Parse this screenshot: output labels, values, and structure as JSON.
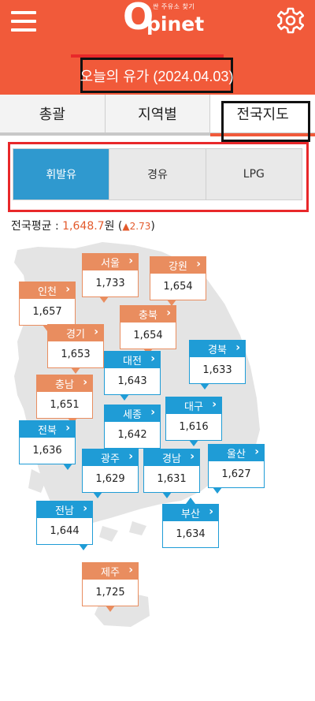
{
  "header": {
    "logo_tagline": "싼 주유소 찾기",
    "logo_o": "O",
    "logo_text": "pinet",
    "date_label": "오늘의 유가 (2024.04.03)",
    "bg_color": "#f15a3a"
  },
  "tabs": [
    {
      "label": "총괄"
    },
    {
      "label": "지역별"
    },
    {
      "label": "전국지도",
      "active": true
    }
  ],
  "fuel_types": [
    {
      "label": "휘발유",
      "active": true
    },
    {
      "label": "경유"
    },
    {
      "label": "LPG"
    }
  ],
  "average": {
    "prefix": "전국평균 : ",
    "value": "1,648.7",
    "unit": "원",
    "change_open": " (",
    "change": "▲2.73",
    "change_close": ")"
  },
  "regions": [
    {
      "name": "서울",
      "price": "1,733",
      "color": "orange"
    },
    {
      "name": "강원",
      "price": "1,654",
      "color": "orange"
    },
    {
      "name": "인천",
      "price": "1,657",
      "color": "orange"
    },
    {
      "name": "충북",
      "price": "1,654",
      "color": "orange"
    },
    {
      "name": "경기",
      "price": "1,653",
      "color": "orange"
    },
    {
      "name": "경북",
      "price": "1,633",
      "color": "blue"
    },
    {
      "name": "대전",
      "price": "1,643",
      "color": "blue"
    },
    {
      "name": "충남",
      "price": "1,651",
      "color": "orange"
    },
    {
      "name": "대구",
      "price": "1,616",
      "color": "blue"
    },
    {
      "name": "세종",
      "price": "1,642",
      "color": "blue"
    },
    {
      "name": "전북",
      "price": "1,636",
      "color": "blue"
    },
    {
      "name": "울산",
      "price": "1,627",
      "color": "blue"
    },
    {
      "name": "광주",
      "price": "1,629",
      "color": "blue"
    },
    {
      "name": "경남",
      "price": "1,631",
      "color": "blue"
    },
    {
      "name": "전남",
      "price": "1,644",
      "color": "blue"
    },
    {
      "name": "부산",
      "price": "1,634",
      "color": "blue"
    },
    {
      "name": "제주",
      "price": "1,725",
      "color": "orange"
    }
  ],
  "icons": {
    "chevron": "›"
  }
}
